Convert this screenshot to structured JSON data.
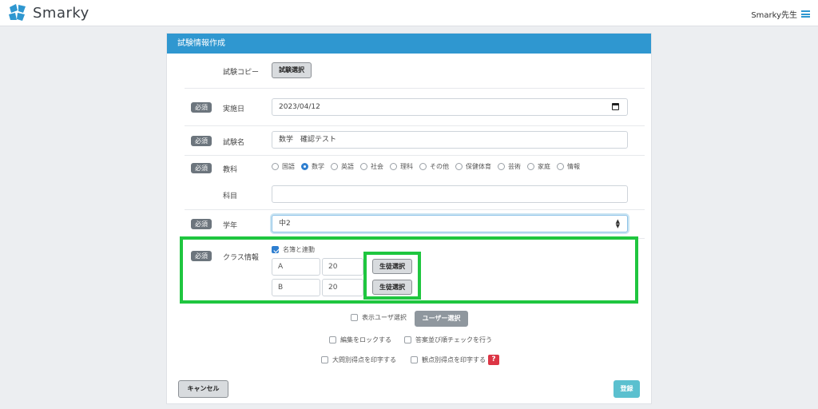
{
  "app": {
    "name": "Smarky",
    "user": "Smarky先生"
  },
  "form": {
    "title": "試験情報作成",
    "copy_label": "試験コピー",
    "copy_button": "試験選択",
    "required": "必須",
    "date_label": "実施日",
    "date_value": "2023/04/12",
    "name_label": "試験名",
    "name_value": "数学　確認テスト",
    "subject_label": "教科",
    "subjects": [
      "国語",
      "数学",
      "英語",
      "社会",
      "理科",
      "その他",
      "保健体育",
      "芸術",
      "家庭",
      "情報"
    ],
    "selected_subject": "数学",
    "course_label": "科目",
    "course_value": "",
    "grade_label": "学年",
    "grade_value": "中2",
    "class_label": "クラス情報",
    "roster_link_label": "名簿と連動",
    "roster_link_checked": true,
    "classes": [
      {
        "name": "A",
        "count": "20",
        "button": "生徒選択"
      },
      {
        "name": "B",
        "count": "20",
        "button": "生徒選択"
      }
    ],
    "display_user_label": "表示ユーザ選択",
    "user_select_button": "ユーザー選択",
    "lock_edit_label": "編集をロックする",
    "answer_order_label": "答案並び順チェックを行う",
    "print_question_label": "大問別得点を印字する",
    "print_viewpoint_label": "観点別得点を印字する",
    "help_symbol": "?",
    "cancel_button": "キャンセル",
    "submit_button": "登録"
  },
  "colors": {
    "brand": "#2f97d0",
    "highlight": "#1fc63f",
    "submit": "#5bc0cf",
    "help": "#dc3545"
  }
}
